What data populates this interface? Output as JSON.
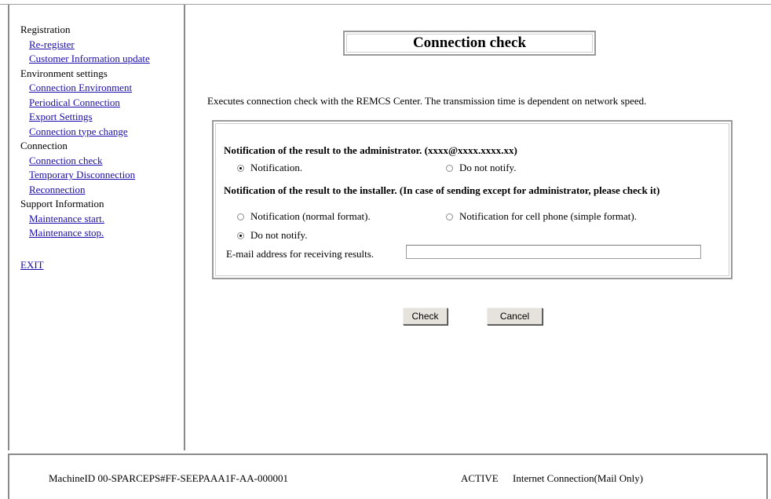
{
  "sidebar": {
    "groups": [
      {
        "label": "Registration",
        "items": [
          "Re-register",
          "Customer Information update"
        ]
      },
      {
        "label": "Environment settings",
        "items": [
          "Connection Environment",
          "Periodical Connection",
          "Export Settings",
          "Connection type change"
        ]
      },
      {
        "label": "Connection",
        "items": [
          "Connection check",
          "Temporary Disconnection",
          "Reconnection"
        ]
      },
      {
        "label": "Support Information",
        "items": [
          "Maintenance start.",
          "Maintenance stop."
        ]
      }
    ],
    "exit": "EXIT"
  },
  "main": {
    "title": "Connection check",
    "description": "Executes connection check with the REMCS Center. The transmission time is dependent on network speed.",
    "admin": {
      "header": "Notification of the result to the administrator. (xxxx@xxxx.xxxx.xx)",
      "opt_notify": "Notification.",
      "opt_no": "Do not notify.",
      "selected": "notify"
    },
    "installer": {
      "header": "Notification of the result to the installer. (In case of sending except for administrator, please check it)",
      "opt_normal": "Notification (normal format).",
      "opt_cell": "Notification for cell phone (simple format).",
      "opt_no": "Do not notify.",
      "selected": "no"
    },
    "email_label": "E-mail address for receiving results.",
    "email_value": "",
    "check_button": "Check",
    "cancel_button": "Cancel"
  },
  "status": {
    "machine": "MachineID 00-SPARCEPS#FF-SEEPAAA1F-AA-000001",
    "state": "ACTIVE",
    "connection": "Internet Connection(Mail Only)"
  }
}
